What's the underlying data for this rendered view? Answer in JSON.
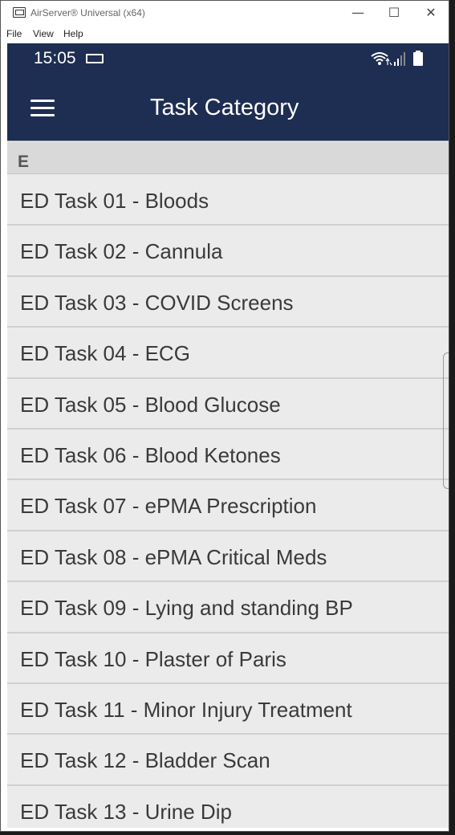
{
  "window": {
    "title": "AirServer® Universal (x64)",
    "minimize": "—",
    "maximize": "☐",
    "close": "✕"
  },
  "menu": [
    "File",
    "View",
    "Help"
  ],
  "status": {
    "time": "15:05"
  },
  "appbar": {
    "title": "Task Category"
  },
  "section": {
    "letter": "E"
  },
  "tasks": [
    "ED Task 01 - Bloods",
    "ED Task 02 - Cannula",
    "ED Task 03 - COVID Screens",
    "ED Task 04 - ECG",
    "ED Task 05 - Blood Glucose",
    "ED Task 06 - Blood Ketones",
    "ED Task 07 - ePMA Prescription",
    "ED Task 08 - ePMA Critical Meds",
    "ED Task 09 - Lying and standing BP",
    "ED Task 10 - Plaster of Paris",
    "ED Task 11 - Minor Injury Treatment",
    "ED Task 12 - Bladder Scan",
    "ED Task 13 - Urine Dip"
  ],
  "colors": {
    "appbar": "#1e2d52",
    "list_bg": "#ebebeb",
    "section_bg": "#d9d9d9"
  }
}
